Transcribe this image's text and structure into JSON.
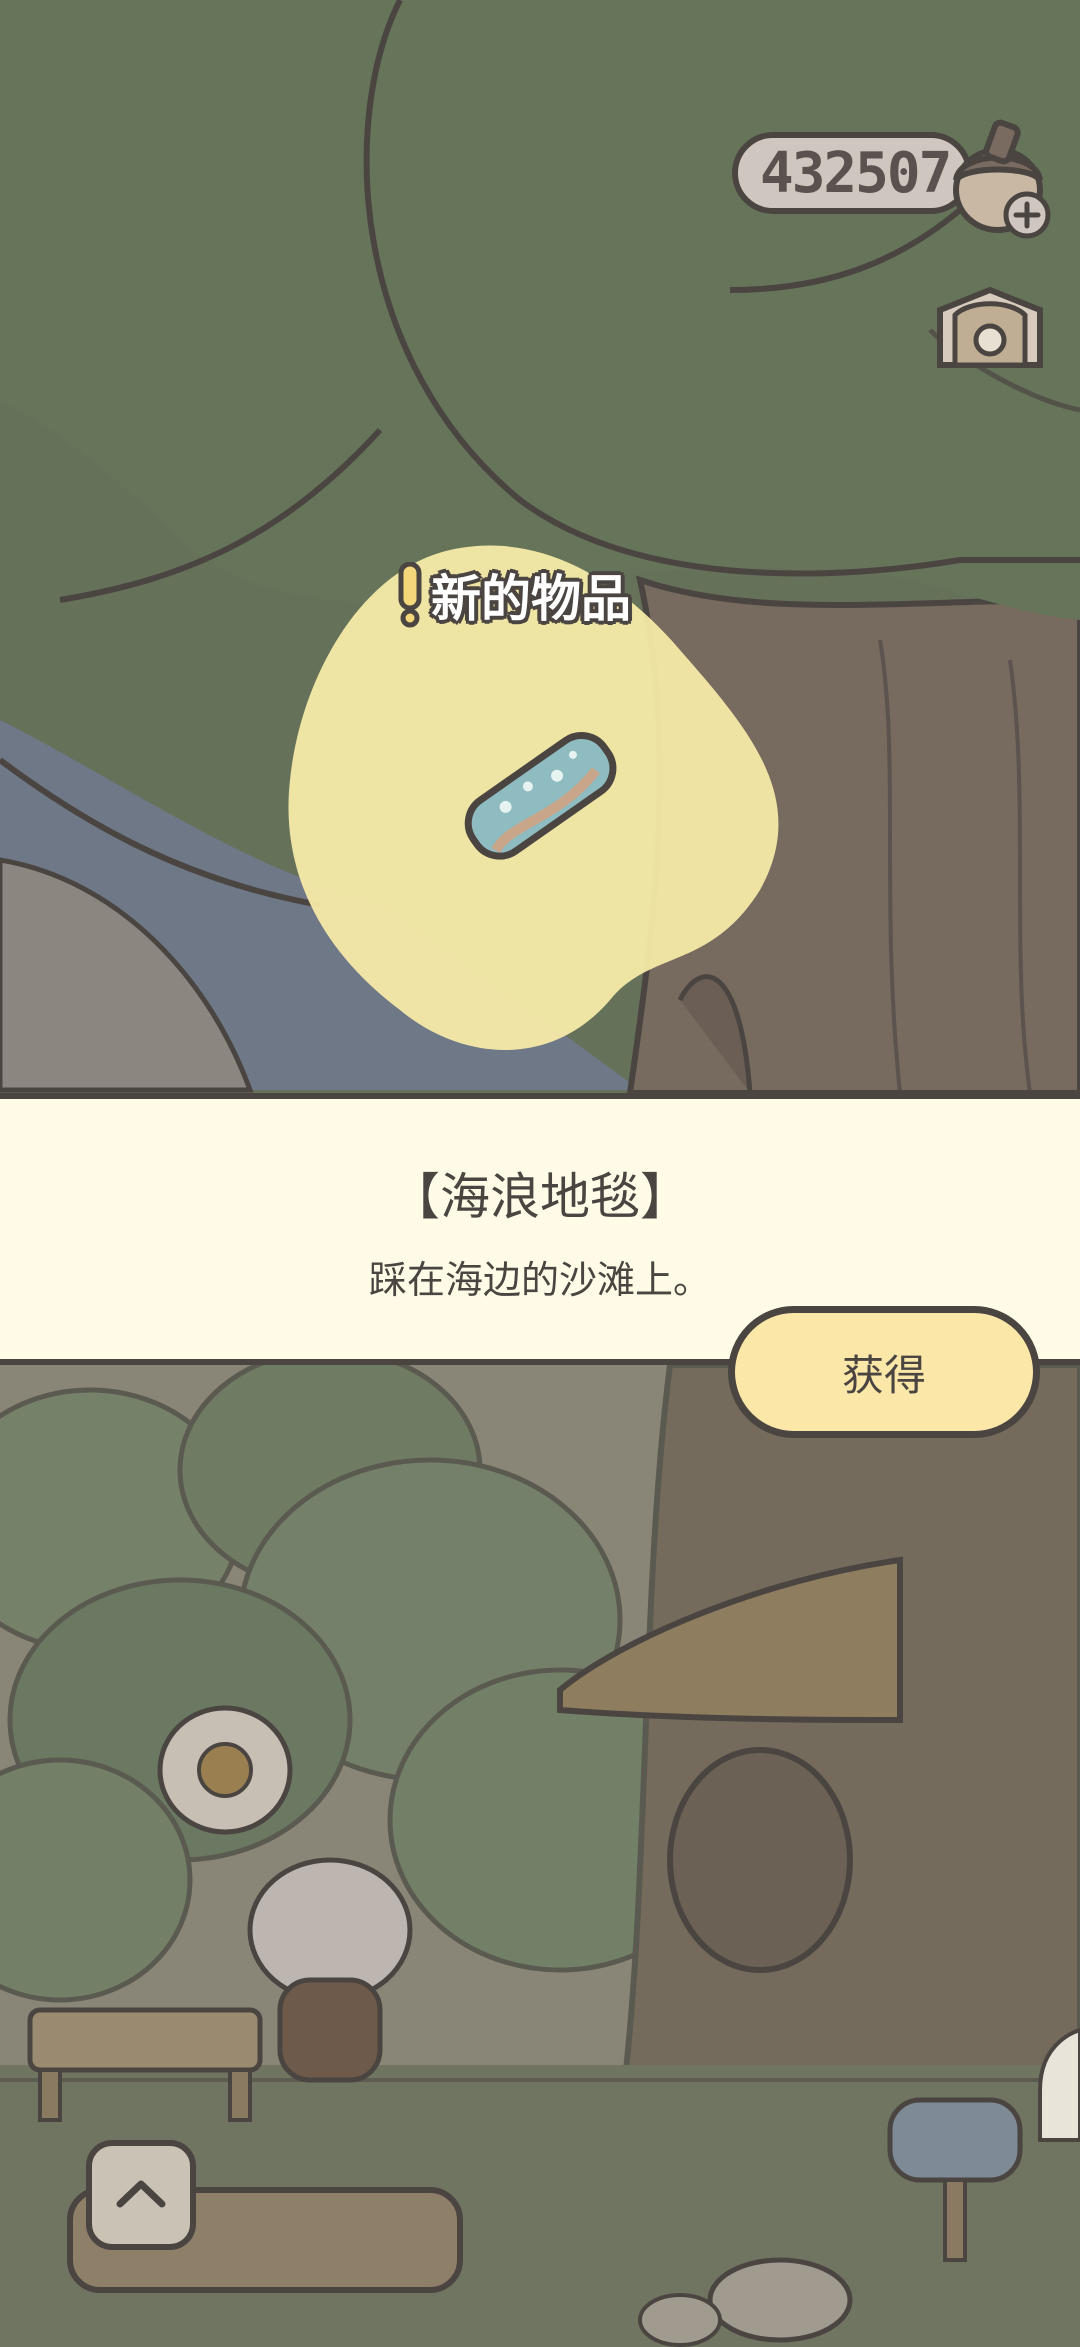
{
  "hud": {
    "coin_count": "432507",
    "currency_icon": "acorn-icon",
    "add_icon": "plus-icon",
    "shop_icon": "shop-icon"
  },
  "new_item": {
    "banner_label": "新的物品",
    "banner_icon": "exclamation-icon",
    "item_icon": "wave-rug-icon"
  },
  "item_panel": {
    "title": "【海浪地毯】",
    "description": "踩在海边的沙滩上。"
  },
  "actions": {
    "obtain_label": "获得",
    "collapse_icon": "chevron-up-icon"
  },
  "colors": {
    "outline": "#4b4542",
    "panel_bg": "#fffbe6",
    "button_bg": "#fbe7a7",
    "highlight": "#f6eaa8"
  }
}
